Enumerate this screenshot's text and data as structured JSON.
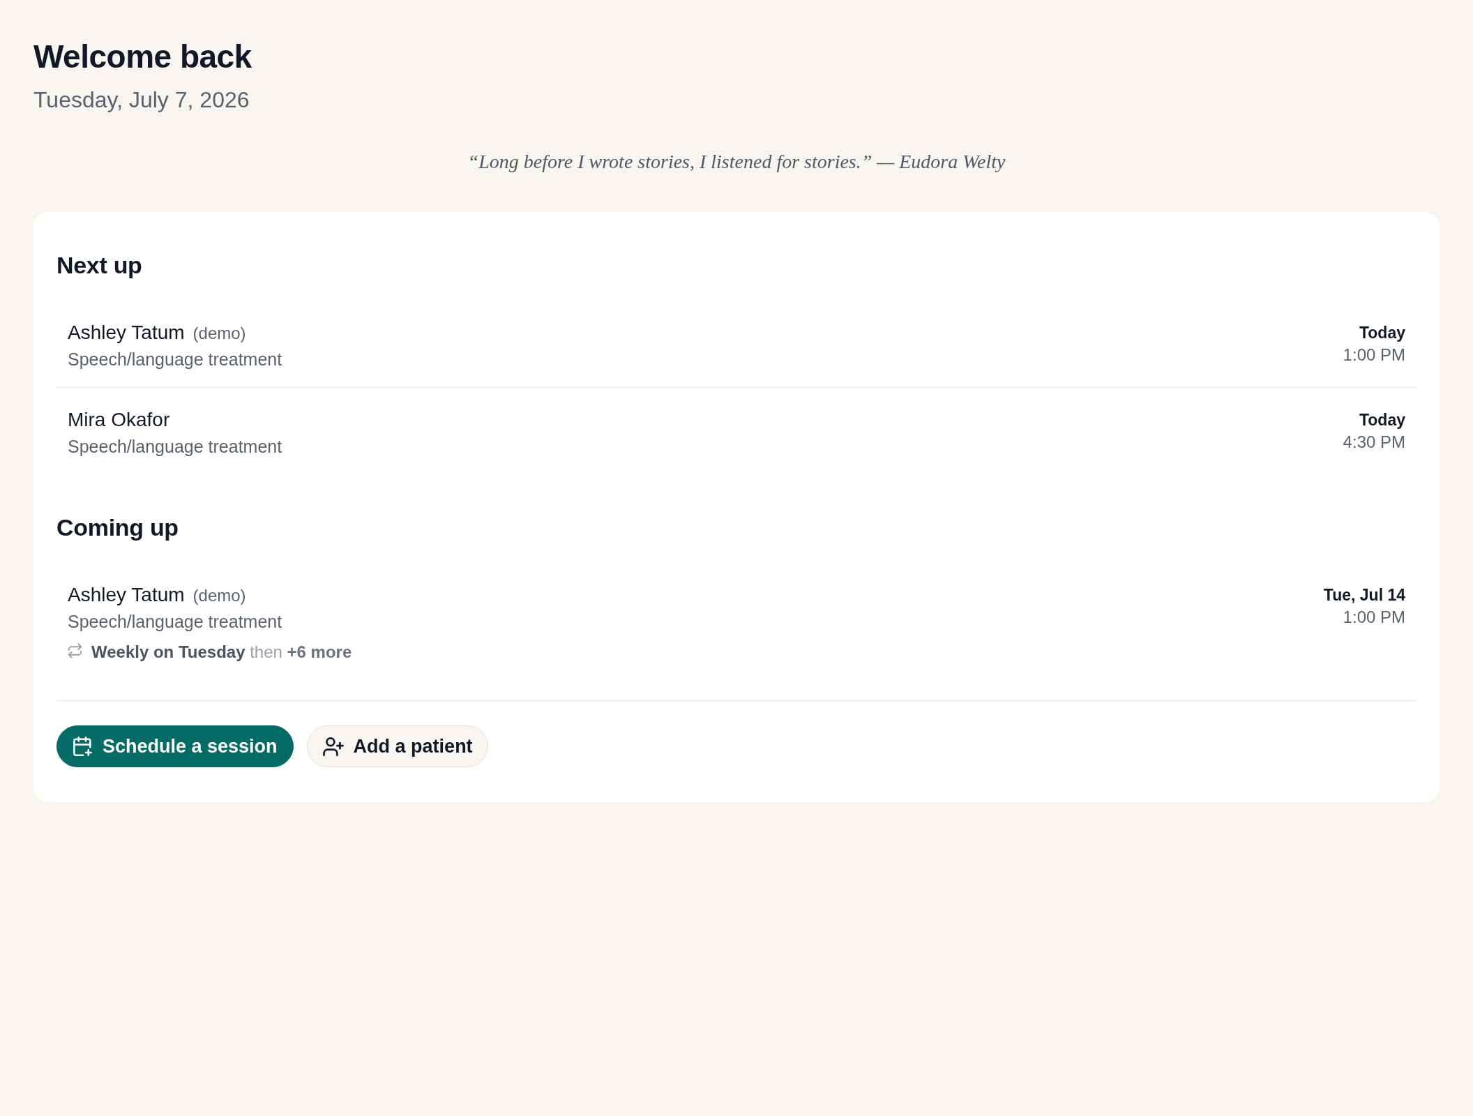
{
  "header": {
    "title": "Welcome back",
    "date": "Tuesday, July 7, 2026"
  },
  "quote": "“Long before I wrote stories, I listened for stories.” — Eudora Welty",
  "sections": [
    {
      "title": "Next up",
      "appointments": [
        {
          "name": "Ashley Tatum",
          "tag": "(demo)",
          "service": "Speech/language treatment",
          "day": "Today",
          "time": "1:00 PM"
        },
        {
          "name": "Mira Okafor",
          "service": "Speech/language treatment",
          "day": "Today",
          "time": "4:30 PM"
        }
      ]
    },
    {
      "title": "Coming up",
      "appointments": [
        {
          "name": "Ashley Tatum",
          "tag": "(demo)",
          "service": "Speech/language treatment",
          "day": "Tue, Jul 14",
          "time": "1:00 PM",
          "recurrence": "**Weekly on Tuesday** then **+6 more**"
        }
      ]
    }
  ],
  "actions": [
    {
      "label": "Schedule a session",
      "kind": "primary"
    },
    {
      "label": "Add a patient",
      "kind": "secondary"
    }
  ]
}
